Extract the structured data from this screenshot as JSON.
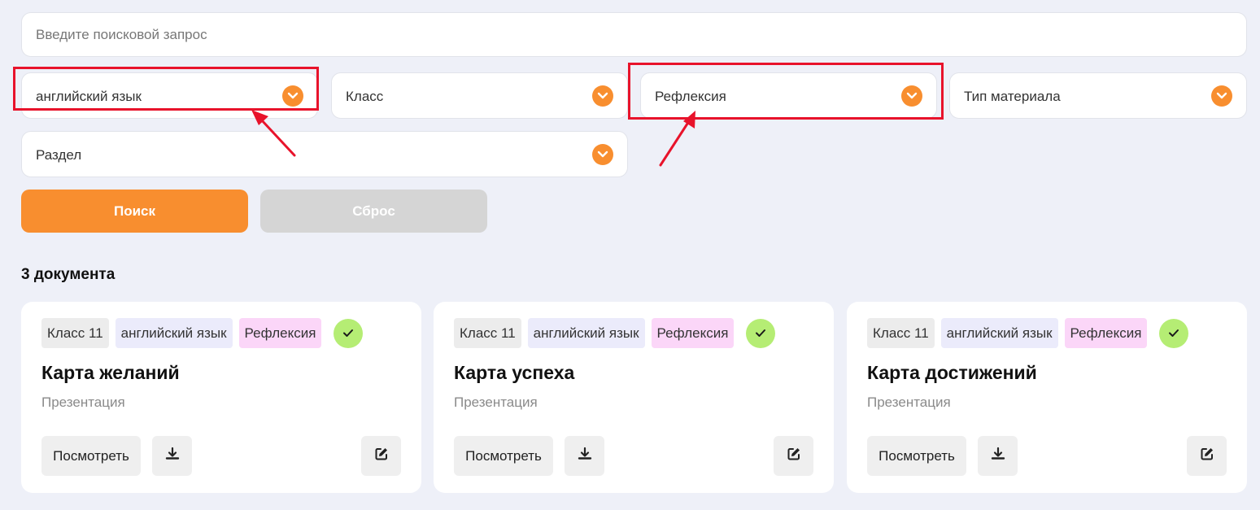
{
  "search": {
    "placeholder": "Введите поисковой запрос"
  },
  "filters": {
    "subject": "английский язык",
    "grade": "Класс",
    "type": "Рефлексия",
    "material_type": "Тип материала",
    "section": "Раздел"
  },
  "buttons": {
    "search": "Поиск",
    "reset": "Сброс"
  },
  "results": {
    "count_label": "3 документа",
    "cards": [
      {
        "grade_tag": "Класс 11",
        "subject_tag": "английский язык",
        "type_tag": "Рефлексия",
        "title": "Карта желаний",
        "kind": "Презентация",
        "view_label": "Посмотреть"
      },
      {
        "grade_tag": "Класс 11",
        "subject_tag": "английский язык",
        "type_tag": "Рефлексия",
        "title": "Карта успеха",
        "kind": "Презентация",
        "view_label": "Посмотреть"
      },
      {
        "grade_tag": "Класс 11",
        "subject_tag": "английский язык",
        "type_tag": "Рефлексия",
        "title": "Карта достижений",
        "kind": "Презентация",
        "view_label": "Посмотреть"
      }
    ]
  },
  "colors": {
    "accent": "#f88e2f",
    "background": "#eef0f8",
    "annotation": "#e8132b",
    "check": "#b5ed74"
  },
  "icons": {
    "dropdown": "chevron-down-icon",
    "verified": "check-icon",
    "download": "download-icon",
    "edit": "edit-icon"
  }
}
